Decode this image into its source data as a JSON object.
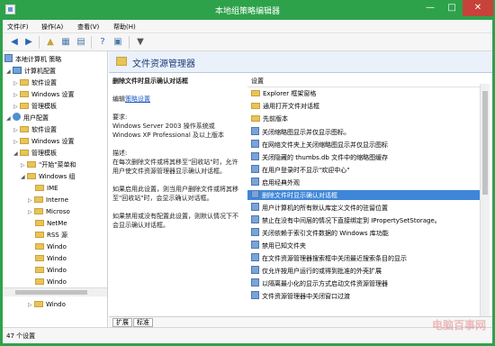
{
  "window": {
    "title": "本地组策略编辑器"
  },
  "menu": [
    "文件(F)",
    "操作(A)",
    "查看(V)",
    "帮助(H)"
  ],
  "tree": {
    "items": [
      {
        "label": "本地计算机 策略",
        "icon": "policy-icon"
      },
      {
        "label": "计算机配置",
        "icon": "computer-icon"
      },
      {
        "label": "软件设置",
        "icon": "folder-icon"
      },
      {
        "label": "Windows 设置",
        "icon": "folder-icon"
      },
      {
        "label": "管理模板",
        "icon": "folder-icon"
      },
      {
        "label": "用户配置",
        "icon": "user-icon"
      },
      {
        "label": "软件设置",
        "icon": "folder-icon"
      },
      {
        "label": "Windows 设置",
        "icon": "folder-icon"
      },
      {
        "label": "管理模板",
        "icon": "folder-icon"
      },
      {
        "label": "\"开始\"菜单和",
        "icon": "folder-icon"
      },
      {
        "label": "Windows 组",
        "icon": "folder-icon"
      },
      {
        "label": "IME",
        "icon": "folder-icon"
      },
      {
        "label": "Interne",
        "icon": "folder-icon"
      },
      {
        "label": "Microso",
        "icon": "folder-icon"
      },
      {
        "label": "NetMe",
        "icon": "folder-icon"
      },
      {
        "label": "RSS 源",
        "icon": "folder-icon"
      },
      {
        "label": "Windo",
        "icon": "folder-icon"
      },
      {
        "label": "Windo",
        "icon": "folder-icon"
      },
      {
        "label": "Windo",
        "icon": "folder-icon"
      },
      {
        "label": "Windo",
        "icon": "folder-icon"
      },
      {
        "label": "Windo",
        "icon": "folder-icon"
      }
    ]
  },
  "panel": {
    "title": "文件资源管理器",
    "description": {
      "heading": "删除文件时显示确认对话框",
      "edit_prefix": "编辑",
      "edit_link": "策略设置",
      "requirements_label": "要求:",
      "requirements_line1": "Windows Server 2003 操作系统或",
      "requirements_line2": "Windows XP Professional 及以上版本",
      "desc_label": "描述:",
      "desc_text": "在每次删除文件或将其移至\"回收站\"时，允许用户使文件资源管理器显示确认对话框。",
      "enabled_text": "如果启用此设置，则当用户删除文件或将其移至\"回收站\"时，会显示确认对话框。",
      "disabled_text": "如果禁用或没有配置此设置，则默认情况下不会显示确认对话框。"
    },
    "list": {
      "header": "设置",
      "items": [
        {
          "label": "Explorer 框架窗格",
          "icon": "folder-icon",
          "selected": false
        },
        {
          "label": "通用打开文件对话框",
          "icon": "folder-icon",
          "selected": false
        },
        {
          "label": "先前版本",
          "icon": "folder-icon",
          "selected": false
        },
        {
          "label": "关闭缩略图显示并仅显示图标。",
          "icon": "policy-icon",
          "selected": false
        },
        {
          "label": "在网络文件夹上关闭缩略图显示并仅显示图标",
          "icon": "policy-icon",
          "selected": false
        },
        {
          "label": "关闭隐藏的 thumbs.db 文件中的缩略图缓存",
          "icon": "policy-icon",
          "selected": false
        },
        {
          "label": "在用户登录时不显示\"欢迎中心\"",
          "icon": "policy-icon",
          "selected": false
        },
        {
          "label": "启用经典外观",
          "icon": "policy-icon",
          "selected": false
        },
        {
          "label": "删除文件时显示确认对话框",
          "icon": "policy-icon",
          "selected": true
        },
        {
          "label": "用户计算机的所有默认库定义文件的驻留位置",
          "icon": "policy-icon",
          "selected": false
        },
        {
          "label": "禁止在没有中间层的情况下直接绑定到 IPropertySetStorage。",
          "icon": "policy-icon",
          "selected": false
        },
        {
          "label": "关闭依赖于索引文件数据的 Windows 库功能",
          "icon": "policy-icon",
          "selected": false
        },
        {
          "label": "禁用已知文件夹",
          "icon": "policy-icon",
          "selected": false
        },
        {
          "label": "在文件资源管理器搜索框中关闭最近搜索条目的显示",
          "icon": "policy-icon",
          "selected": false
        },
        {
          "label": "仅允许按用户运行的或得到批准的外壳扩展",
          "icon": "policy-icon",
          "selected": false
        },
        {
          "label": "以隔离最小化的显示方式启动文件资源管理器",
          "icon": "policy-icon",
          "selected": false
        },
        {
          "label": "文件资源管理器中关闭窗口过渡",
          "icon": "policy-icon",
          "selected": false
        }
      ]
    },
    "tabs": [
      "扩展",
      "标准"
    ]
  },
  "status": {
    "text": "47 个设置"
  },
  "watermark": "电脑百事网",
  "colors": {
    "accent": "#2ea24b",
    "selection": "#3f86d8"
  }
}
